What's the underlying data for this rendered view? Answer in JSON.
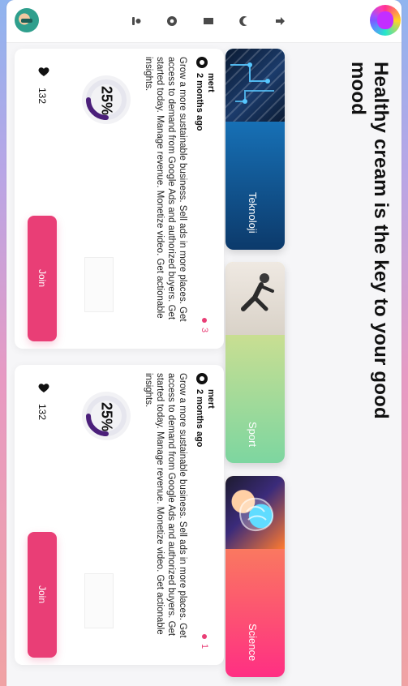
{
  "topbar": {
    "icons": [
      "avatar",
      "profile-icon",
      "eye-icon",
      "folder-icon",
      "theme-toggle-icon",
      "arrow-right-icon",
      "brand-logo"
    ]
  },
  "main": {
    "title": "Healthy cream is the key to your good mood",
    "categories": [
      {
        "label": "Teknoloji"
      },
      {
        "label": "Sport"
      },
      {
        "label": "Science"
      }
    ],
    "cards": [
      {
        "author": "mert",
        "date": "2 months ago",
        "text": "Grow a more sustainable business. Sell ads in more places. Get access to demand from Google Ads and authorized buyers. Get started today. Manage revenue. Monetize video. Get actionable insights.",
        "progress_text": "25%",
        "progress_value": 0.25,
        "likes": "132",
        "join_label": "Join",
        "count": "3"
      },
      {
        "author": "mert",
        "date": "2 months ago",
        "text": "Grow a more sustainable business. Sell ads in more places. Get access to demand from Google Ads and authorized buyers. Get started today. Manage revenue. Monetize video. Get actionable insights.",
        "progress_text": "25%",
        "progress_value": 0.25,
        "likes": "132",
        "join_label": "Join",
        "count": "1"
      }
    ]
  },
  "colors": {
    "accent": "#e93e76",
    "progress": "#4b1f7a",
    "teknoloji_gradient": [
      "#1d8fe0",
      "#0c3a6b"
    ],
    "sport_gradient": [
      "#f4e38a",
      "#7dd6a0"
    ],
    "science_gradient": [
      "#f7a24c",
      "#ff2f83"
    ]
  }
}
